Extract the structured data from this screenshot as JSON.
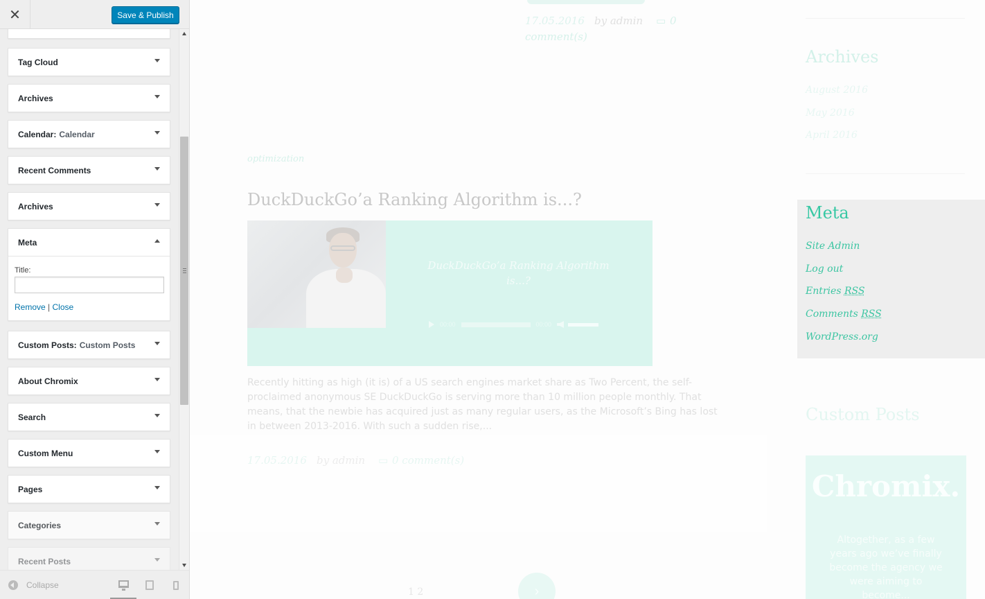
{
  "header": {
    "close_icon": "close-icon",
    "close_glyph": "✕",
    "publish_label": "Save & Publish"
  },
  "widgets": [
    {
      "title": "Tag Cloud",
      "subtitle": ""
    },
    {
      "title": "Archives",
      "subtitle": ""
    },
    {
      "title": "Calendar:",
      "subtitle": "Calendar"
    },
    {
      "title": "Recent Comments",
      "subtitle": ""
    },
    {
      "title": "Archives",
      "subtitle": ""
    },
    {
      "title": "Meta",
      "subtitle": ""
    },
    {
      "title": "Custom Posts:",
      "subtitle": "Custom Posts"
    },
    {
      "title": "About Chromix",
      "subtitle": ""
    },
    {
      "title": "Search",
      "subtitle": ""
    },
    {
      "title": "Custom Menu",
      "subtitle": ""
    },
    {
      "title": "Pages",
      "subtitle": ""
    },
    {
      "title": "Categories",
      "subtitle": ""
    },
    {
      "title": "Recent Posts",
      "subtitle": ""
    }
  ],
  "meta_form": {
    "title_label": "Title:",
    "title_value": "",
    "remove_label": "Remove",
    "separator": "|",
    "close_label": "Close"
  },
  "footer": {
    "collapse_label": "Collapse",
    "devices": [
      "desktop",
      "tablet",
      "mobile"
    ],
    "active_device": "desktop"
  },
  "preview": {
    "post1": {
      "date": "17.05.2016",
      "author": "by admin",
      "comments_count": "0",
      "comments_label": "comment(s)"
    },
    "post2": {
      "category": "optimization",
      "title": "DuckDuckGo’a Ranking Algorithm is...?",
      "media_caption": "DuckDuckGo’a Ranking Algorithm is...?",
      "audio_current": "00:00",
      "audio_duration": "00:00",
      "excerpt": "Recently hitting as high (it is) of a US search engines market share as Two Percent, the self-proclaimed anonymous SE DuckDuckGo is serving more than 10 million people monthly. That means, that the newbie has acquired just as many regular users, as the Microsoft’s Bing has lost in between 2013-2016. With such a sudden rise,...",
      "date": "17.05.2016",
      "author": "by admin",
      "comments": "0 comment(s)"
    },
    "pagination": {
      "pages": "1   2",
      "next_glyph": "›"
    },
    "sidebar": {
      "archives_title": "Archives",
      "archives_links": [
        "August 2016",
        "May 2016",
        "April 2016"
      ],
      "meta_title": "Meta",
      "meta_links": {
        "site_admin": "Site Admin",
        "log_out": "Log out",
        "entries": "Entries",
        "comments": "Comments",
        "rss": "RSS",
        "wordpress": "WordPress.org"
      },
      "custom_posts_title": "Custom Posts",
      "chromix_logo": "Chromix.",
      "chromix_text": "Altogether, as a few years ago we’ve finally become the agency we were aiming to become..."
    }
  },
  "colors": {
    "accent": "#0085ba",
    "teal": "#37c8a4",
    "sidebar_bg": "#eeeeee"
  }
}
